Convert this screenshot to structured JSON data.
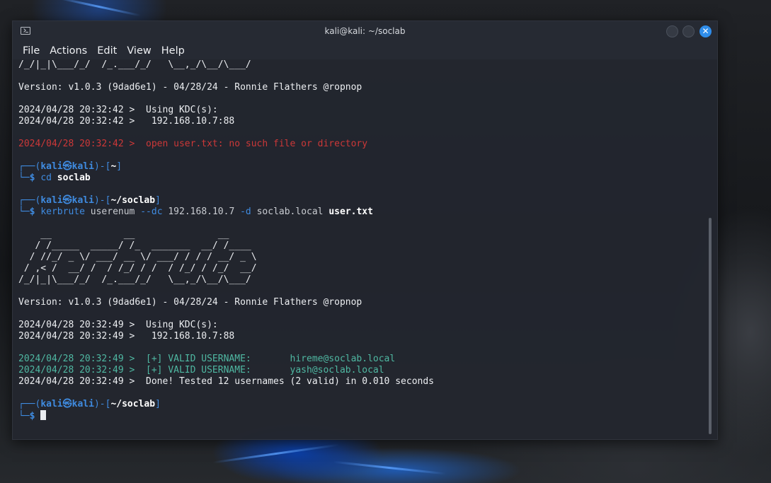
{
  "window": {
    "title": "kali@kali: ~/soclab",
    "close_glyph": "✕"
  },
  "menu": [
    "File",
    "Actions",
    "Edit",
    "View",
    "Help"
  ],
  "terminal": {
    "lines": [
      {
        "kind": "plain",
        "text": "/_/|_|\\___/_/  /_.___/_/   \\__,_/\\__/\\___/"
      },
      {
        "kind": "blank"
      },
      {
        "kind": "plain",
        "text": "Version: v1.0.3 (9dad6e1) - 04/28/24 - Ronnie Flathers @ropnop"
      },
      {
        "kind": "blank"
      },
      {
        "kind": "plain",
        "text": "2024/04/28 20:32:42 >  Using KDC(s):"
      },
      {
        "kind": "plain",
        "text": "2024/04/28 20:32:42 >   192.168.10.7:88"
      },
      {
        "kind": "blank"
      },
      {
        "kind": "error",
        "text": "2024/04/28 20:32:42 >  open user.txt: no such file or directory"
      },
      {
        "kind": "blank"
      },
      {
        "kind": "prompt",
        "user": "kali",
        "at": "㉿",
        "host": "kali",
        "path": "~"
      },
      {
        "kind": "command",
        "parts": [
          {
            "t": "cd",
            "s": "blue"
          },
          {
            "t": " ",
            "s": ""
          },
          {
            "t": "soclab",
            "s": "bold"
          }
        ]
      },
      {
        "kind": "blank"
      },
      {
        "kind": "prompt",
        "user": "kali",
        "at": "㉿",
        "host": "kali",
        "path": "~/soclab"
      },
      {
        "kind": "command",
        "parts": [
          {
            "t": "kerbrute",
            "s": "blue"
          },
          {
            "t": " userenum ",
            "s": "dim"
          },
          {
            "t": "--dc",
            "s": "blue"
          },
          {
            "t": " 192.168.10.7 ",
            "s": "dim"
          },
          {
            "t": "-d",
            "s": "blue"
          },
          {
            "t": " soclab.local ",
            "s": "dim"
          },
          {
            "t": "user.txt",
            "s": "bold"
          }
        ]
      },
      {
        "kind": "blank"
      },
      {
        "kind": "plain",
        "text": "    __             __               __"
      },
      {
        "kind": "plain",
        "text": "   / /_____  _____/ /_  _______  __/ /____"
      },
      {
        "kind": "plain",
        "text": "  / //_/ _ \\/ ___/ __ \\/ ___/ / / / __/ _ \\"
      },
      {
        "kind": "plain",
        "text": " / ,< /  __/ /  / /_/ / /  / /_/ / /_/  __/"
      },
      {
        "kind": "plain",
        "text": "/_/|_|\\___/_/  /_.___/_/   \\__,_/\\__/\\___/"
      },
      {
        "kind": "blank"
      },
      {
        "kind": "plain",
        "text": "Version: v1.0.3 (9dad6e1) - 04/28/24 - Ronnie Flathers @ropnop"
      },
      {
        "kind": "blank"
      },
      {
        "kind": "plain",
        "text": "2024/04/28 20:32:49 >  Using KDC(s):"
      },
      {
        "kind": "plain",
        "text": "2024/04/28 20:32:49 >   192.168.10.7:88"
      },
      {
        "kind": "blank"
      },
      {
        "kind": "valid",
        "text": "2024/04/28 20:32:49 >  [+] VALID USERNAME:       hireme@soclab.local"
      },
      {
        "kind": "valid",
        "text": "2024/04/28 20:32:49 >  [+] VALID USERNAME:       yash@soclab.local"
      },
      {
        "kind": "plain",
        "text": "2024/04/28 20:32:49 >  Done! Tested 12 usernames (2 valid) in 0.010 seconds"
      },
      {
        "kind": "blank"
      },
      {
        "kind": "prompt",
        "user": "kali",
        "at": "㉿",
        "host": "kali",
        "path": "~/soclab"
      },
      {
        "kind": "input",
        "prefix": "$"
      }
    ]
  },
  "prompt": {
    "top_prefix": "┌──(",
    "close_paren": ")-[",
    "close_bracket": "]",
    "bottom_prefix": "└─",
    "dollar": "$"
  },
  "colors": {
    "error": "#cc3838",
    "valid": "#4fb8a2",
    "prompt_blue": "#3f8be0",
    "close_button": "#2f8dea"
  }
}
